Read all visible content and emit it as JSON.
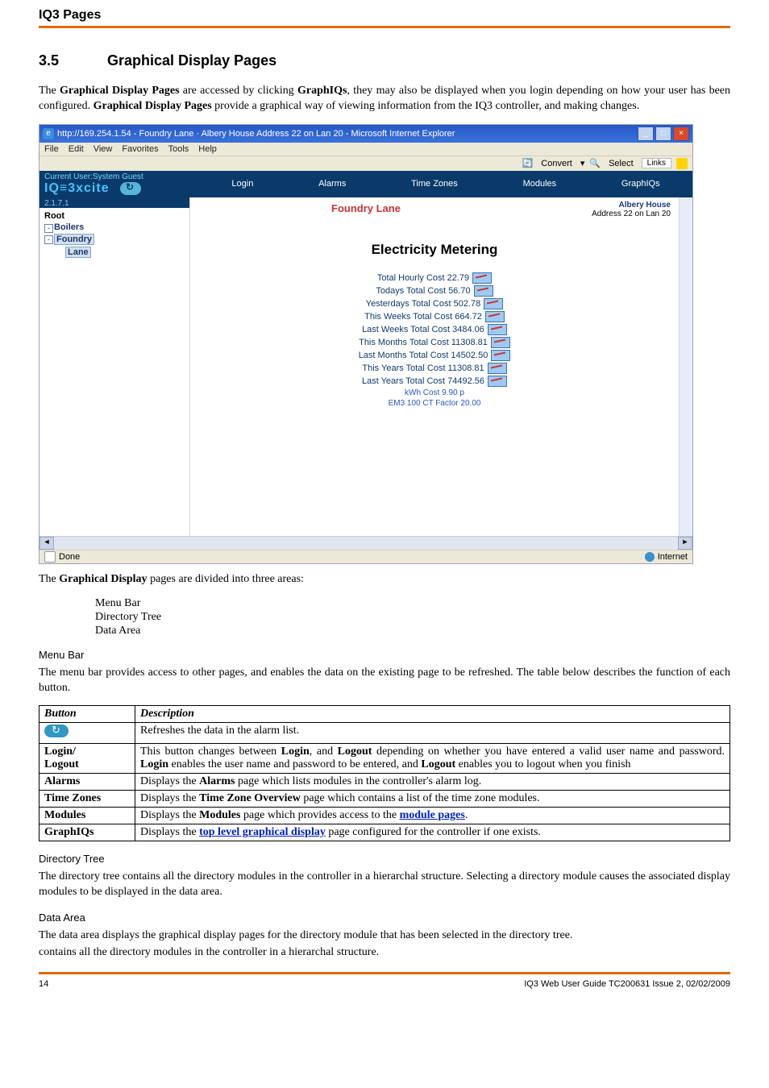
{
  "header": {
    "title": "IQ3 Pages"
  },
  "section": {
    "number": "3.5",
    "title": "Graphical Display Pages"
  },
  "intro": "The Graphical Display Pages are accessed by clicking GraphIQs, they may also be displayed when you login depending on how your user has been configured. Graphical Display Pages provide a graphical way of viewing information from the IQ3 controller, and making changes.",
  "screenshot": {
    "titlebar": "http://169.254.1.54 - Foundry Lane · Albery House Address 22 on Lan 20 - Microsoft Internet Explorer",
    "menu": {
      "file": "File",
      "edit": "Edit",
      "view": "View",
      "favorites": "Favorites",
      "tools": "Tools",
      "help": "Help"
    },
    "toolbar": {
      "convert": "Convert",
      "select": "Select",
      "links": "Links"
    },
    "nav": {
      "current_user": "Current User:System Guest",
      "logo": "IQ≡3xcite",
      "login": "Login",
      "alarms": "Alarms",
      "timezones": "Time Zones",
      "modules": "Modules",
      "graphiqs": "GraphIQs"
    },
    "subheader": "2.1.7.1",
    "tree": {
      "root": "Root",
      "boilers": "Boilers",
      "foundry": "Foundry",
      "lane": "Lane"
    },
    "location": {
      "title": "Foundry Lane",
      "house": "Albery House",
      "addr": "Address 22 on Lan 20"
    },
    "panel": {
      "title": "Electricity Metering",
      "metrics": [
        "Total Hourly Cost 22.79",
        "Todays Total Cost 56.70",
        "Yesterdays Total Cost 502.78",
        "This Weeks Total Cost 664.72",
        "Last Weeks Total Cost 3484.06",
        "This Months Total Cost 11308.81",
        "Last Months Total Cost 14502.50",
        "This Years Total Cost 11308.81",
        "Last Years Total Cost 74492.56"
      ],
      "extras": [
        "kWh Cost 9.90 p",
        "EM3 100 CT Factor 20.00"
      ]
    },
    "statusbar": {
      "done": "Done",
      "zone": "Internet"
    }
  },
  "after_shot": "The Graphical Display pages are divided into three areas:",
  "areas": [
    "Menu Bar",
    "Directory Tree",
    "Data Area"
  ],
  "menubar_section": {
    "heading": "Menu Bar",
    "text": "The menu bar provides access to other pages, and enables the data on the existing page to be refreshed. The table below describes the function of each button."
  },
  "table": {
    "h1": "Button",
    "h2": "Description",
    "rows": {
      "refresh_desc": "Refreshes the data in the alarm list.",
      "login_label": "Login/\nLogout",
      "login_desc_1": "This button changes between ",
      "login_desc_2": ", and ",
      "login_desc_3": " depending on whether you have entered a valid user name and password. ",
      "login_desc_4": " enables the user name and password to be entered, and ",
      "login_desc_5": " enables you to logout when you finish",
      "login_b1": "Login",
      "login_b2": "Logout",
      "login_b3": "Login",
      "login_b4": "Logout",
      "alarms_label": "Alarms",
      "alarms_desc_1": "Displays the ",
      "alarms_b": "Alarms",
      "alarms_desc_2": " page which lists modules in the controller's alarm log.",
      "tz_label": "Time Zones",
      "tz_desc_1": "Displays the ",
      "tz_b": "Time Zone Overview",
      "tz_desc_2": " page which contains a list of the time zone modules.",
      "mod_label": "Modules",
      "mod_desc_1": "Displays the ",
      "mod_b": "Modules",
      "mod_desc_2": " page which provides access to the ",
      "mod_link": "module pages",
      "mod_desc_3": ".",
      "giq_label": "GraphIQs",
      "giq_desc_1": "Displays the ",
      "giq_link": "top level graphical display",
      "giq_desc_2": " page configured for the controller if one exists."
    }
  },
  "dirtree_section": {
    "heading": "Directory Tree",
    "text": "The directory tree contains all the directory modules in the controller in a hierarchal structure. Selecting a directory module causes the associated display modules to be displayed in the data area."
  },
  "dataarea_section": {
    "heading": "Data Area",
    "text": "The data area displays the graphical display pages for the directory module that has been selected in the directory tree.",
    "text2": " contains all the directory modules in the controller in a hierarchal structure."
  },
  "footer": {
    "page": "14",
    "ref": "IQ3 Web User Guide TC200631 Issue 2, 02/02/2009"
  }
}
